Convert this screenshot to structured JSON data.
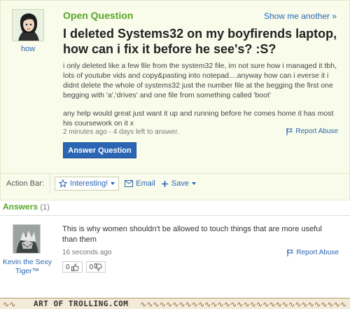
{
  "question": {
    "asker_name": "how",
    "status_label": "Open Question",
    "show_more_label": "Show me another »",
    "title": "I deleted Systems32 on my boyfirends laptop, how can i fix it before he see's? :S?",
    "body_paragraphs": [
      "i only deleted like a few file from the system32 file, im not sure how i managed it tbh, lots of youtube vids and copy&pasting into notepad....anyway how can i everse it i didnt delete the whole of systems32 just the number file at the begging the first one begging with 'a','drives' and one file from something called 'boot'",
      "any help would great just want it up and running before he comes home it has most his coursework on it x"
    ],
    "meta": "2 minutes ago - 4 days left to answer.",
    "report_label": "Report Abuse",
    "answer_button_label": "Answer Question"
  },
  "action_bar": {
    "label": "Action Bar:",
    "interesting_label": "Interesting!",
    "email_label": "Email",
    "save_label": "Save"
  },
  "answers": {
    "heading": "Answers",
    "count": "(1)",
    "items": [
      {
        "author": "Kevin the Sexy Tiger™",
        "text": "This is why women shouldn't be allowed to touch things that are more useful than them",
        "meta": "16 seconds ago",
        "report_label": "Report Abuse",
        "thumbs_up": "0",
        "thumbs_down": "0"
      }
    ]
  },
  "footer": {
    "watermark": "ART OF TROLLING.COM"
  },
  "colors": {
    "accent_green": "#56a62a",
    "link_blue": "#2a66b3",
    "question_bg": "#fafceb"
  }
}
